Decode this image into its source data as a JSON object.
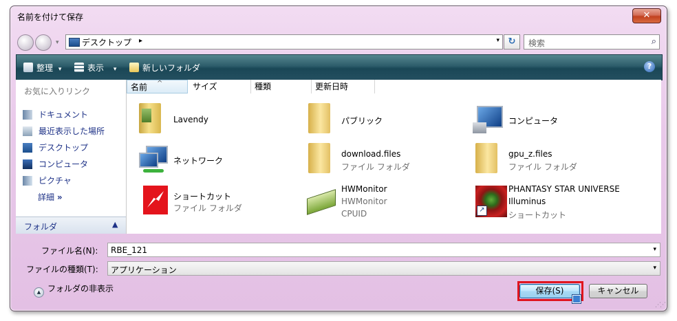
{
  "window": {
    "title": "名前を付けて保存",
    "close_glyph": "✕"
  },
  "address": {
    "location": "デスクトップ",
    "arrow": "▸",
    "dropdown": "▾",
    "refresh": "↻"
  },
  "search": {
    "placeholder": "検索",
    "icon": "search-icon"
  },
  "toolbar": {
    "organize": "整理",
    "views": "表示",
    "new_folder": "新しいフォルダ",
    "dropdown": "▾",
    "help": "?"
  },
  "favorites": {
    "title": "お気に入りリンク",
    "items": [
      {
        "label": "ドキュメント",
        "icon": "documents-icon"
      },
      {
        "label": "最近表示した場所",
        "icon": "recent-places-icon"
      },
      {
        "label": "デスクトップ",
        "icon": "desktop-icon"
      },
      {
        "label": "コンピュータ",
        "icon": "computer-icon"
      },
      {
        "label": "ピクチャ",
        "icon": "pictures-icon"
      }
    ],
    "more": "詳細",
    "more_glyph": "»"
  },
  "folders_bar": {
    "label": "フォルダ",
    "chevron": "▲"
  },
  "columns": {
    "name": "名前",
    "size": "サイズ",
    "type": "種類",
    "date": "更新日時",
    "sort_glyph": "^"
  },
  "files": [
    {
      "line1": "Lavendy",
      "line2": "",
      "line3": "",
      "icon": "user-folder-icon"
    },
    {
      "line1": "パブリック",
      "line2": "",
      "line3": "",
      "icon": "folder-icon"
    },
    {
      "line1": "コンピュータ",
      "line2": "",
      "line3": "",
      "icon": "computer-icon"
    },
    {
      "line1": "ネットワーク",
      "line2": "",
      "line3": "",
      "icon": "network-icon"
    },
    {
      "line1": "download.files",
      "line2": "ファイル フォルダ",
      "line3": "",
      "icon": "folder-icon"
    },
    {
      "line1": "gpu_z.files",
      "line2": "ファイル フォルダ",
      "line3": "",
      "icon": "folder-icon"
    },
    {
      "line1": "ショートカット",
      "line2": "ファイル フォルダ",
      "line3": "",
      "icon": "shortcut-logo-icon"
    },
    {
      "line1": "HWMonitor",
      "line2": "HWMonitor",
      "line3": "CPUID",
      "icon": "hwmonitor-icon"
    },
    {
      "line1": "PHANTASY STAR UNIVERSE",
      "line2": "Illuminus",
      "line3": "ショートカット",
      "icon": "game-shortcut-icon"
    }
  ],
  "form": {
    "filename_label": "ファイル名(N):",
    "filename_value": "RBE_121",
    "filetype_label": "ファイルの種類(T):",
    "filetype_value": "アプリケーション",
    "dropdown": "▾",
    "hide_folders": "フォルダの非表示",
    "hide_glyph": "▲",
    "save": "保存(S)",
    "cancel": "キャンセル"
  },
  "colors": {
    "highlight": "#e0141e",
    "link": "#1e3287",
    "toolbar": "#1a4756"
  }
}
